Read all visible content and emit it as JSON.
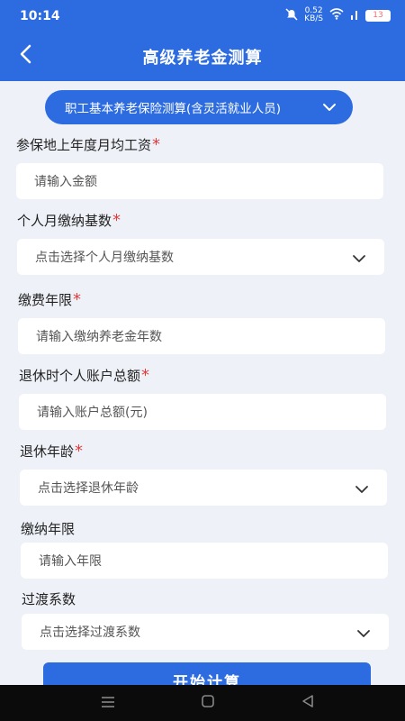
{
  "status_bar": {
    "time": "10:14",
    "net_speed_value": "0.52",
    "net_speed_unit": "KB/S",
    "battery": "13"
  },
  "header": {
    "title": "高级养老金测算"
  },
  "type_selector": {
    "label": "职工基本养老保险测算(含灵活就业人员)"
  },
  "fields": [
    {
      "label": "参保地上年度月均工资",
      "required": "*",
      "placeholder": "请输入金额"
    },
    {
      "label": "个人月缴纳基数",
      "required": "*",
      "placeholder": "点击选择个人月缴纳基数"
    },
    {
      "label": "缴费年限",
      "required": "*",
      "placeholder": "请输入缴纳养老金年数"
    },
    {
      "label": "退休时个人账户总额",
      "required": "*",
      "placeholder": "请输入账户总额(元)"
    },
    {
      "label": "退休年龄",
      "required": "*",
      "placeholder": "点击选择退休年龄"
    },
    {
      "label": "缴纳年限",
      "placeholder": "请输入年限"
    },
    {
      "label": "过渡系数",
      "placeholder": "点击选择过渡系数"
    }
  ],
  "submit": {
    "label": "开始计算"
  },
  "colors": {
    "accent": "#2d6ce0",
    "required": "#e23b3b",
    "background": "#eef2f8"
  }
}
